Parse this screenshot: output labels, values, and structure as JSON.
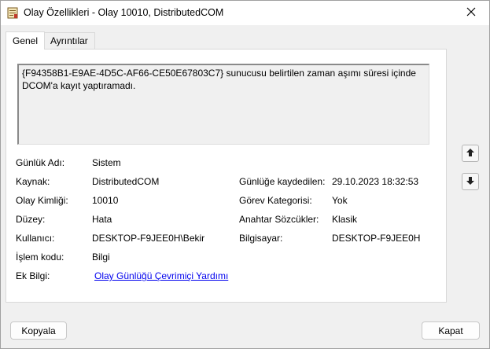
{
  "window": {
    "title": "Olay Özellikleri - Olay 10010, DistributedCOM",
    "title_icon": "event-properties-icon",
    "close_icon": "close-icon"
  },
  "tabs": [
    {
      "label": "Genel",
      "active": true
    },
    {
      "label": "Ayrıntılar",
      "active": false
    }
  ],
  "description": {
    "line1": "{F94358B1-E9AE-4D5C-AF66-CE50E67803C7} sunucusu belirtilen zaman aşımı süresi içinde",
    "line2": "DCOM'a kayıt yaptıramadı."
  },
  "fields": {
    "log_name": {
      "label": "Günlük Adı:",
      "value": "Sistem"
    },
    "source": {
      "label": "Kaynak:",
      "value": "DistributedCOM"
    },
    "event_id": {
      "label": "Olay Kimliği:",
      "value": "10010"
    },
    "level": {
      "label": "Düzey:",
      "value": "Hata"
    },
    "user": {
      "label": "Kullanıcı:",
      "value": "DESKTOP-F9JEE0H\\Bekir"
    },
    "opcode": {
      "label": "İşlem kodu:",
      "value": "Bilgi"
    },
    "more_info": {
      "label": "Ek Bilgi:",
      "value": "Olay Günlüğü Çevrimiçi Yardımı"
    },
    "logged": {
      "label": "Günlüğe kaydedilen:",
      "value": "29.10.2023 18:32:53"
    },
    "task_category": {
      "label": "Görev Kategorisi:",
      "value": "Yok"
    },
    "keywords": {
      "label": "Anahtar Sözcükler:",
      "value": "Klasik"
    },
    "computer": {
      "label": "Bilgisayar:",
      "value": "DESKTOP-F9JEE0H"
    }
  },
  "nav": {
    "up_icon": "arrow-up-icon",
    "down_icon": "arrow-down-icon"
  },
  "buttons": {
    "copy": "Kopyala",
    "close": "Kapat"
  }
}
